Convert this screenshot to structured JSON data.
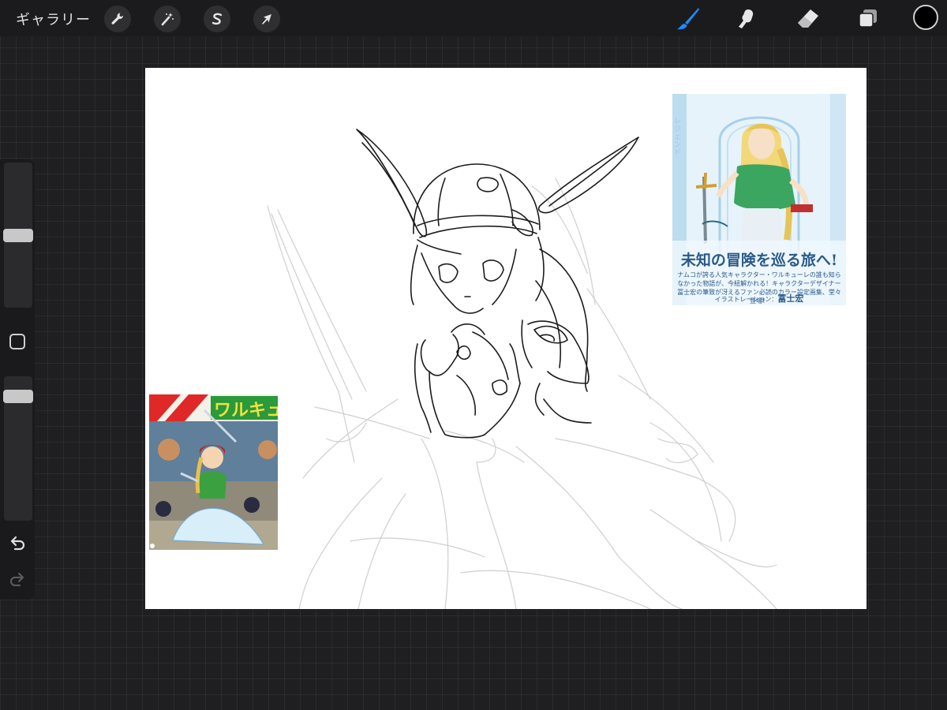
{
  "topbar": {
    "gallery_label": "ギャラリー",
    "left_tools": [
      {
        "name": "actions",
        "icon": "wrench-icon"
      },
      {
        "name": "adjustments",
        "icon": "magic-wand-icon"
      },
      {
        "name": "selection",
        "icon": "selection-s-icon"
      },
      {
        "name": "transform",
        "icon": "arrow-cursor-icon"
      }
    ],
    "right_tools": [
      {
        "name": "brush",
        "icon": "brush-icon",
        "active": true
      },
      {
        "name": "smudge",
        "icon": "smudge-finger-icon",
        "active": false
      },
      {
        "name": "eraser",
        "icon": "eraser-icon",
        "active": false
      },
      {
        "name": "layers",
        "icon": "layers-icon",
        "active": false
      }
    ],
    "current_color": "#000000",
    "accent_color": "#1a8cff"
  },
  "sidebar": {
    "brush_size_level": 0.5,
    "opacity_level": 0.1,
    "modify_icon": "square-modify-icon",
    "undo_icon": "undo-arrow-icon",
    "redo_icon": "redo-arrow-icon"
  },
  "canvas": {
    "background": "#ffffff",
    "reference_right": {
      "side_text": "レジェンド",
      "title": "未知の冒険を巡る旅へ!",
      "description": "ナムコが誇る人気キャラクター・ワルキューレの誰も知らなかった物語が、今紐解かれる！キャラクターデザイナー冨士宏の筆致が冴えるファン必読のカラー設定画集、堂々登場！",
      "credit_label": "イラストレーション：",
      "credit_name": "冨士宏"
    },
    "reference_left": {
      "title": "ワルキュ"
    }
  }
}
